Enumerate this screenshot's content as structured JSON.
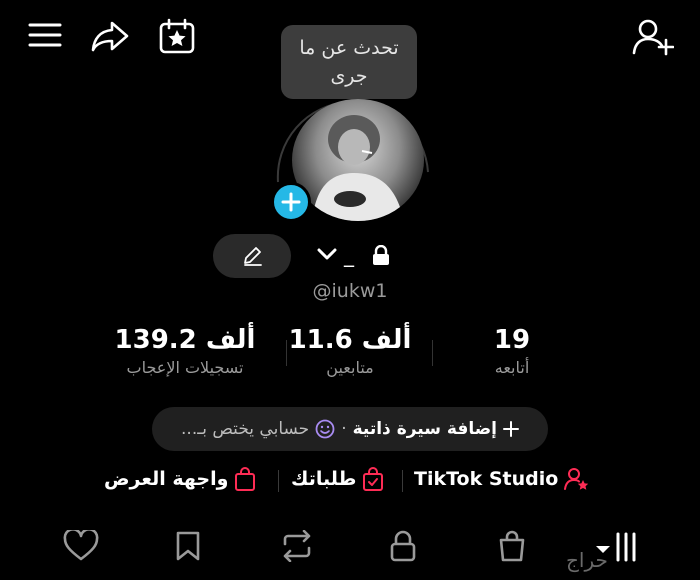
{
  "topbar": {
    "menu_icon": "hamburger-menu-icon",
    "share_icon": "share-arrow-icon",
    "calendar_icon": "calendar-star-icon",
    "add_user_icon": "add-user-icon"
  },
  "tooltip": {
    "line1": "تحدث عن ما",
    "line2": "جرى"
  },
  "profile": {
    "username": "@iukw1",
    "name_placeholder": "_"
  },
  "stats": [
    {
      "value": "139.2 ألف",
      "label": "تسجيلات الإعجاب"
    },
    {
      "value": "11.6 ألف",
      "label": "متابعين"
    },
    {
      "value": "19",
      "label": "أتابعه"
    }
  ],
  "bio": {
    "add_label": "إضافة سيرة ذاتية",
    "separator": "·",
    "desc": "حسابي يختص بـ..."
  },
  "links": {
    "studio": "TikTok Studio",
    "orders": "طلباتك",
    "showcase": "واجهة العرض"
  },
  "tabs": [
    "liked",
    "favorites",
    "reposts",
    "private",
    "shop",
    "videos"
  ],
  "watermark": "حراج",
  "colors": {
    "accent": "#25b8e6",
    "pink": "#fe2c55",
    "background": "#000000"
  }
}
